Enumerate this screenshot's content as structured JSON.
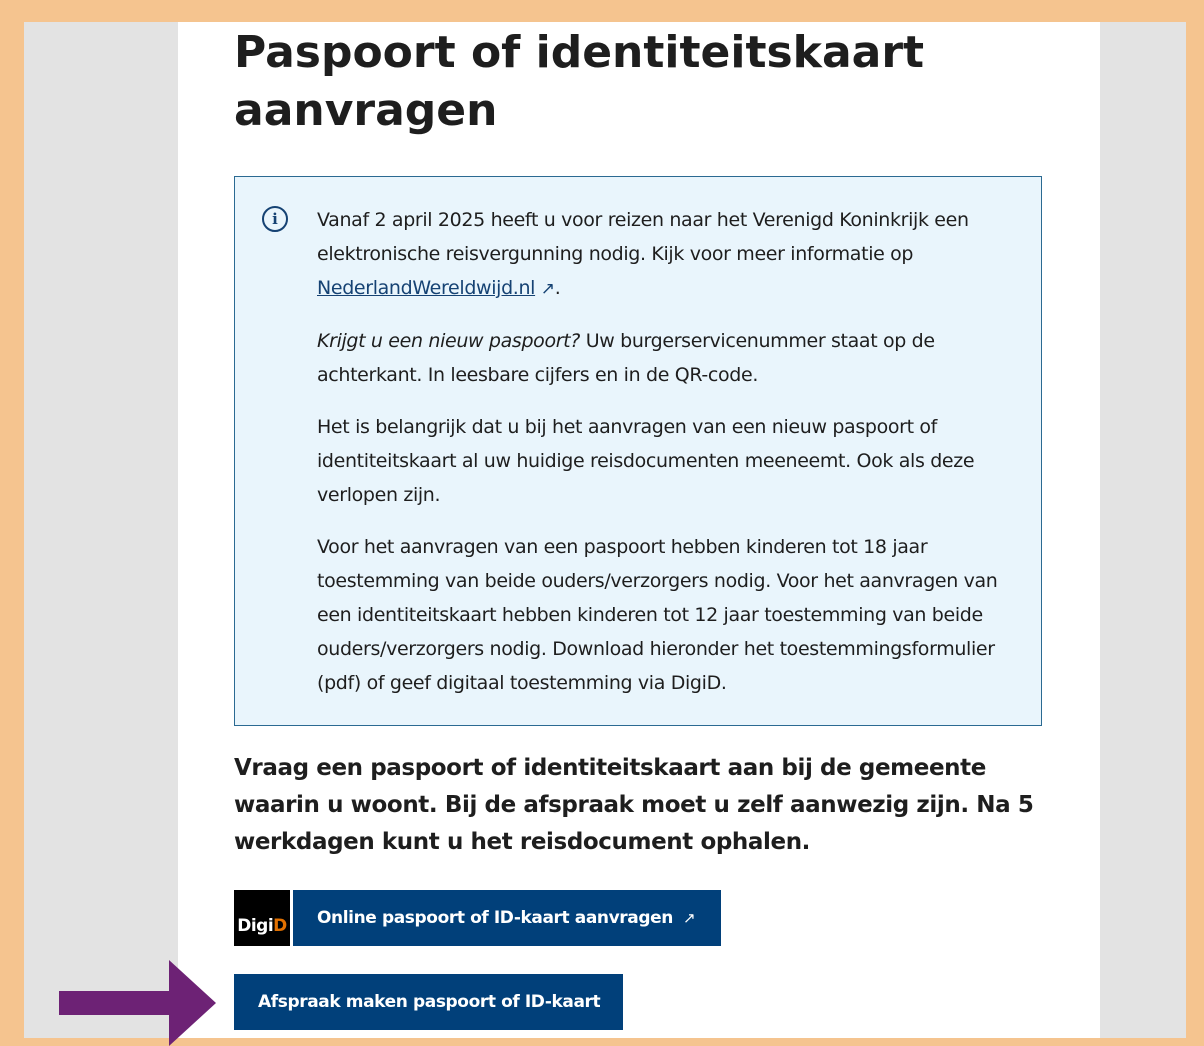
{
  "page": {
    "title": "Paspoort of identiteitskaart aanvragen"
  },
  "info": {
    "p1_text": "Vanaf 2 april 2025 heeft u voor reizen naar het Verenigd Koninkrijk een elektronische reisvergunning nodig. Kijk voor meer informatie op ",
    "p1_link": "NederlandWereldwijd.nl",
    "p1_end": ".",
    "p2_em": "Krijgt u een nieuw paspoort?",
    "p2_text": " Uw burgerservicenummer staat op de achterkant. In leesbare cijfers en in de QR-code.",
    "p3": "Het is belangrijk dat u bij het aanvragen van een nieuw paspoort of identiteitskaart al uw huidige reisdocumenten meeneemt. Ook als deze verlopen zijn.",
    "p4": "Voor het aanvragen van een paspoort hebben kinderen tot 18 jaar toestemming van beide ouders/verzorgers nodig. Voor het aanvragen van een identiteitskaart hebben kinderen tot 12 jaar toestemming van beide ouders/verzorgers nodig. Download hieronder het toestemmingsformulier (pdf) of geef digitaal toestemming via DigiD."
  },
  "lead": "Vraag een paspoort of identiteitskaart aan bij de gemeente waarin u woont. Bij de afspraak moet u zelf aanwezig zijn. Na 5 werkdagen kunt u het reisdocument ophalen.",
  "digid": {
    "logo_prefix": "Digi",
    "logo_suffix": "D"
  },
  "buttons": {
    "online": "Online paspoort of ID-kaart aanvragen",
    "afspraak": "Afspraak maken paspoort of ID-kaart"
  },
  "icons": {
    "info": "info-circle-icon",
    "external": "external-link-icon",
    "arrow": "arrow-right-icon"
  },
  "colors": {
    "frame": "#f5c48f",
    "side_background": "#e3e3e3",
    "info_background": "#e9f5fc",
    "info_border": "#2b6a92",
    "button": "#01407a",
    "link": "#154273",
    "digid_accent": "#e17000",
    "arrow": "#6d2275"
  }
}
